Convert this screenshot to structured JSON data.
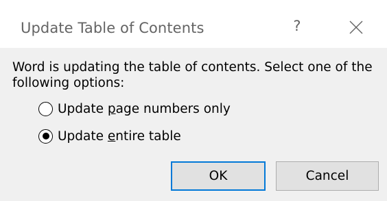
{
  "dialog": {
    "title": "Update Table of Contents",
    "help_label": "?",
    "close_icon": "close-icon"
  },
  "message": "Word is updating the table of contents.  Select one of the following options:",
  "options": [
    {
      "label_pre": "Update ",
      "label_mnemonic": "p",
      "label_post": "age numbers only",
      "selected": false
    },
    {
      "label_pre": "Update ",
      "label_mnemonic": "e",
      "label_post": "ntire table",
      "selected": true
    }
  ],
  "buttons": {
    "ok_label": "OK",
    "cancel_label": "Cancel"
  },
  "colors": {
    "focus_border": "#0078d7",
    "dialog_bg": "#f0f0f0",
    "titlebar_bg": "#ffffff",
    "title_text": "#646464"
  }
}
